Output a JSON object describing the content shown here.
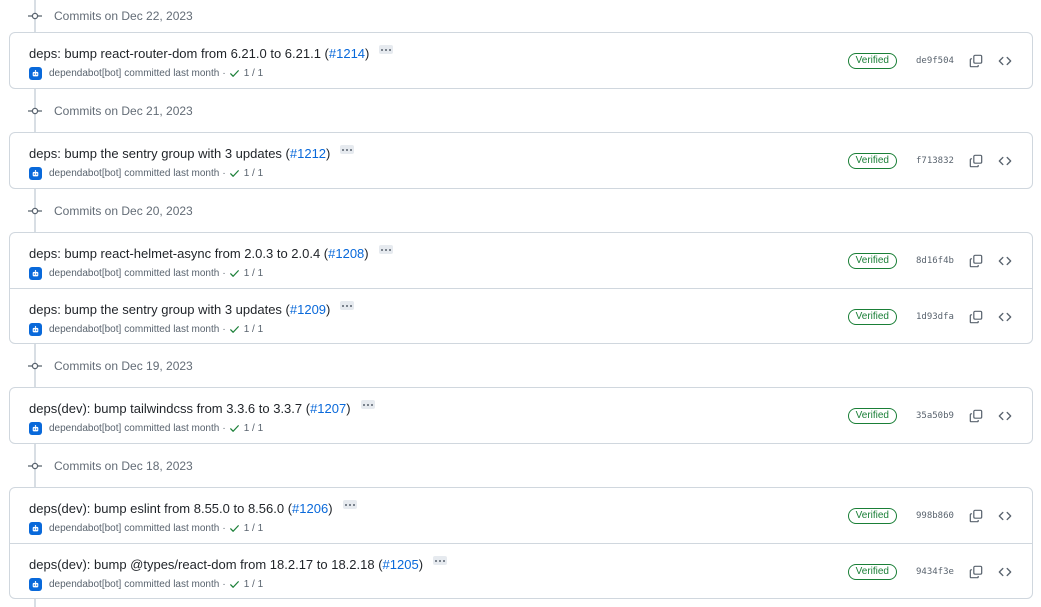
{
  "groups": [
    {
      "label": "Commits on Dec 22, 2023",
      "commits": [
        {
          "title": "deps: bump react-router-dom from 6.21.0 to 6.21.1 (",
          "pr": "#1214",
          "title_end": ")",
          "author": "dependabot[bot]",
          "action": "committed last month",
          "checks": "1 / 1",
          "verified": "Verified",
          "sha": "de9f504"
        }
      ]
    },
    {
      "label": "Commits on Dec 21, 2023",
      "commits": [
        {
          "title": "deps: bump the sentry group with 3 updates (",
          "pr": "#1212",
          "title_end": ")",
          "author": "dependabot[bot]",
          "action": "committed last month",
          "checks": "1 / 1",
          "verified": "Verified",
          "sha": "f713832"
        }
      ]
    },
    {
      "label": "Commits on Dec 20, 2023",
      "commits": [
        {
          "title": "deps: bump react-helmet-async from 2.0.3 to 2.0.4 (",
          "pr": "#1208",
          "title_end": ")",
          "author": "dependabot[bot]",
          "action": "committed last month",
          "checks": "1 / 1",
          "verified": "Verified",
          "sha": "8d16f4b"
        },
        {
          "title": "deps: bump the sentry group with 3 updates (",
          "pr": "#1209",
          "title_end": ")",
          "author": "dependabot[bot]",
          "action": "committed last month",
          "checks": "1 / 1",
          "verified": "Verified",
          "sha": "1d93dfa"
        }
      ]
    },
    {
      "label": "Commits on Dec 19, 2023",
      "commits": [
        {
          "title": "deps(dev): bump tailwindcss from 3.3.6 to 3.3.7 (",
          "pr": "#1207",
          "title_end": ")",
          "author": "dependabot[bot]",
          "action": "committed last month",
          "checks": "1 / 1",
          "verified": "Verified",
          "sha": "35a50b9"
        }
      ]
    },
    {
      "label": "Commits on Dec 18, 2023",
      "commits": [
        {
          "title": "deps(dev): bump eslint from 8.55.0 to 8.56.0 (",
          "pr": "#1206",
          "title_end": ")",
          "author": "dependabot[bot]",
          "action": "committed last month",
          "checks": "1 / 1",
          "verified": "Verified",
          "sha": "998b860"
        },
        {
          "title": "deps(dev): bump @types/react-dom from 18.2.17 to 18.2.18 (",
          "pr": "#1205",
          "title_end": ")",
          "author": "dependabot[bot]",
          "action": "committed last month",
          "checks": "1 / 1",
          "verified": "Verified",
          "sha": "9434f3e"
        }
      ]
    }
  ],
  "icons": {
    "commit_node": "git-commit-icon",
    "avatar": "bot-avatar-icon",
    "check": "check-icon",
    "copy": "copy-icon",
    "browse": "code-icon",
    "ellipsis": "ellipsis-icon"
  },
  "colors": {
    "accent": "#0969da",
    "verified": "#1a7f37",
    "border": "#d0d7de",
    "muted": "#59636e"
  }
}
